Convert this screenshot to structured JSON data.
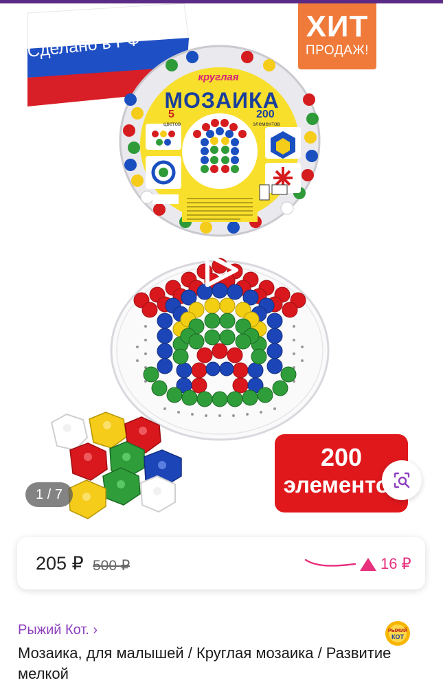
{
  "gallery": {
    "flag_text": "Сделано в РФ",
    "hit_line1": "ХИТ",
    "hit_line2": "ПРОДАЖ!",
    "box_subtitle": "круглая",
    "box_title": "МОЗАИКА",
    "box_colors_num": "5",
    "box_colors_word": "цветов",
    "box_elements_num": "200",
    "box_elements_word": "элементов",
    "count_num": "200",
    "count_word": "элементов",
    "counter": "1 / 7"
  },
  "price": {
    "current": "205 ₽",
    "old": "500 ₽",
    "diff": "16 ₽",
    "diff_color": "#e8307d"
  },
  "seller": {
    "name": "Рыжий Кот. ›",
    "logo_text": "РЫЖИЙ КОТ"
  },
  "product": {
    "title": "Мозаика, для малышей / Круглая мозаика / Развитие мелкой"
  },
  "colors": {
    "accent": "#5b2a86",
    "seller_link": "#8e3fbf",
    "badge_red": "#e0181c",
    "badge_orange": "#f07a3a"
  },
  "icons": [
    "play-icon",
    "visual-search-icon",
    "price-trend-up-icon"
  ]
}
